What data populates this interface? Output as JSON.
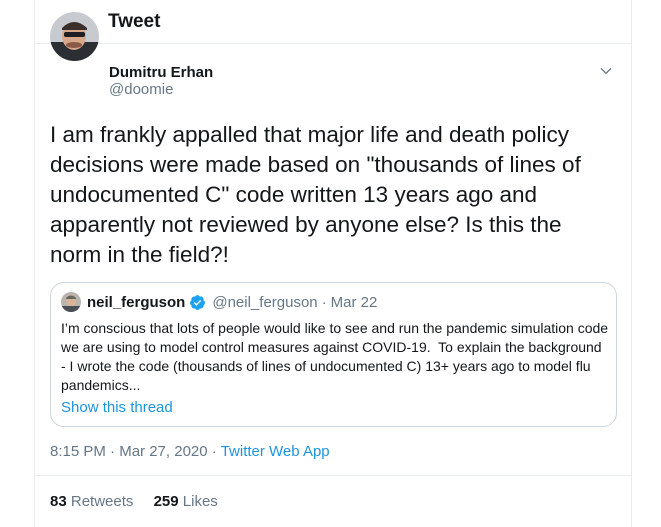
{
  "header": {
    "title": "Tweet"
  },
  "tweet": {
    "author_name": "Dumitru Erhan",
    "author_handle": "@doomie",
    "text": "I am frankly appalled that major life and death policy decisions were made based on \"thousands of lines of undocumented C\" code written 13 years ago and apparently not reviewed by anyone else? Is this the norm in the field?!",
    "time": "8:15 PM",
    "date": "Mar 27, 2020",
    "source": "Twitter Web App",
    "retweets_count": "83",
    "retweets_label": "Retweets",
    "likes_count": "259",
    "likes_label": "Likes"
  },
  "quoted": {
    "author_name": "neil_ferguson",
    "author_handle": "@neil_ferguson",
    "date": "Mar 22",
    "text": "I’m conscious that lots of people would like to see and run the pandemic simulation code we are using to model control measures against COVID-19.  To explain the background - I wrote the code (thousands of lines of undocumented C) 13+ years ago to model flu pandemics...",
    "show_thread": "Show this thread"
  },
  "colors": {
    "accent": "#1b95e0",
    "secondary_text": "#657786",
    "border": "#e6ecf0"
  }
}
